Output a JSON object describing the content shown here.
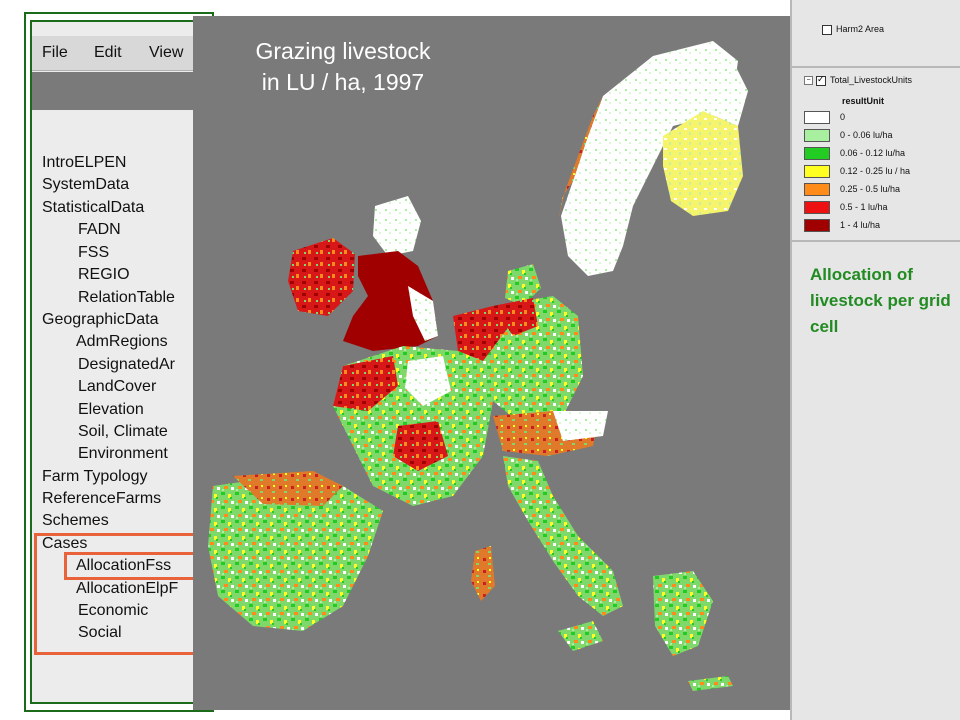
{
  "app": {
    "menu": [
      "File",
      "Edit",
      "View"
    ],
    "tree": [
      {
        "label": "IntroELPEN",
        "level": 0
      },
      {
        "label": "SystemData",
        "level": 0
      },
      {
        "label": "StatisticalData",
        "level": 0
      },
      {
        "label": "FADN",
        "level": 1
      },
      {
        "label": "FSS",
        "level": 1
      },
      {
        "label": "REGIO",
        "level": 1
      },
      {
        "label": "RelationTable",
        "level": 1
      },
      {
        "label": "GeographicData",
        "level": 0
      },
      {
        "label": "AdmRegions",
        "level": 1
      },
      {
        "label": "DesignatedAr",
        "level": 1
      },
      {
        "label": "LandCover",
        "level": 1
      },
      {
        "label": "Elevation",
        "level": 1
      },
      {
        "label": "Soil, Climate",
        "level": 1
      },
      {
        "label": "Environment",
        "level": 1
      },
      {
        "label": "Farm Typology",
        "level": 0
      },
      {
        "label": "ReferenceFarms",
        "level": 0
      },
      {
        "label": "Schemes",
        "level": 0
      },
      {
        "label": "Cases",
        "level": 0
      },
      {
        "label": "AllocationFss",
        "level": 1
      },
      {
        "label": "AllocationElpF",
        "level": 1
      },
      {
        "label": "Economic",
        "level": 1
      },
      {
        "label": "Social",
        "level": 1
      }
    ]
  },
  "map": {
    "title_line1": "Grazing livestock",
    "title_line2": "in LU / ha, 1997",
    "background": "#7a7a7a"
  },
  "legend": {
    "layer_top": "Harm2 Area",
    "layer_main": "Total_LivestockUnits",
    "unit_label": "resultUnit",
    "classes": [
      {
        "label": "0",
        "color": "#ffffff"
      },
      {
        "label": "0 - 0.06 lu/ha",
        "color": "#a8f0a0"
      },
      {
        "label": "0.06 - 0.12 lu/ha",
        "color": "#22cc22"
      },
      {
        "label": "0.12 - 0.25 lu / ha",
        "color": "#ffff22"
      },
      {
        "label": "0.25 - 0.5 lu/ha",
        "color": "#ff8c1a"
      },
      {
        "label": "0.5 - 1 lu/ha",
        "color": "#ee1111"
      },
      {
        "label": "1 - 4 lu/ha",
        "color": "#a00000"
      }
    ],
    "caption": "Allocation of livestock per grid cell"
  },
  "colors": {
    "frame_green": "#1b6b1b",
    "highlight_orange": "#e8633a",
    "caption_green": "#228b22"
  }
}
